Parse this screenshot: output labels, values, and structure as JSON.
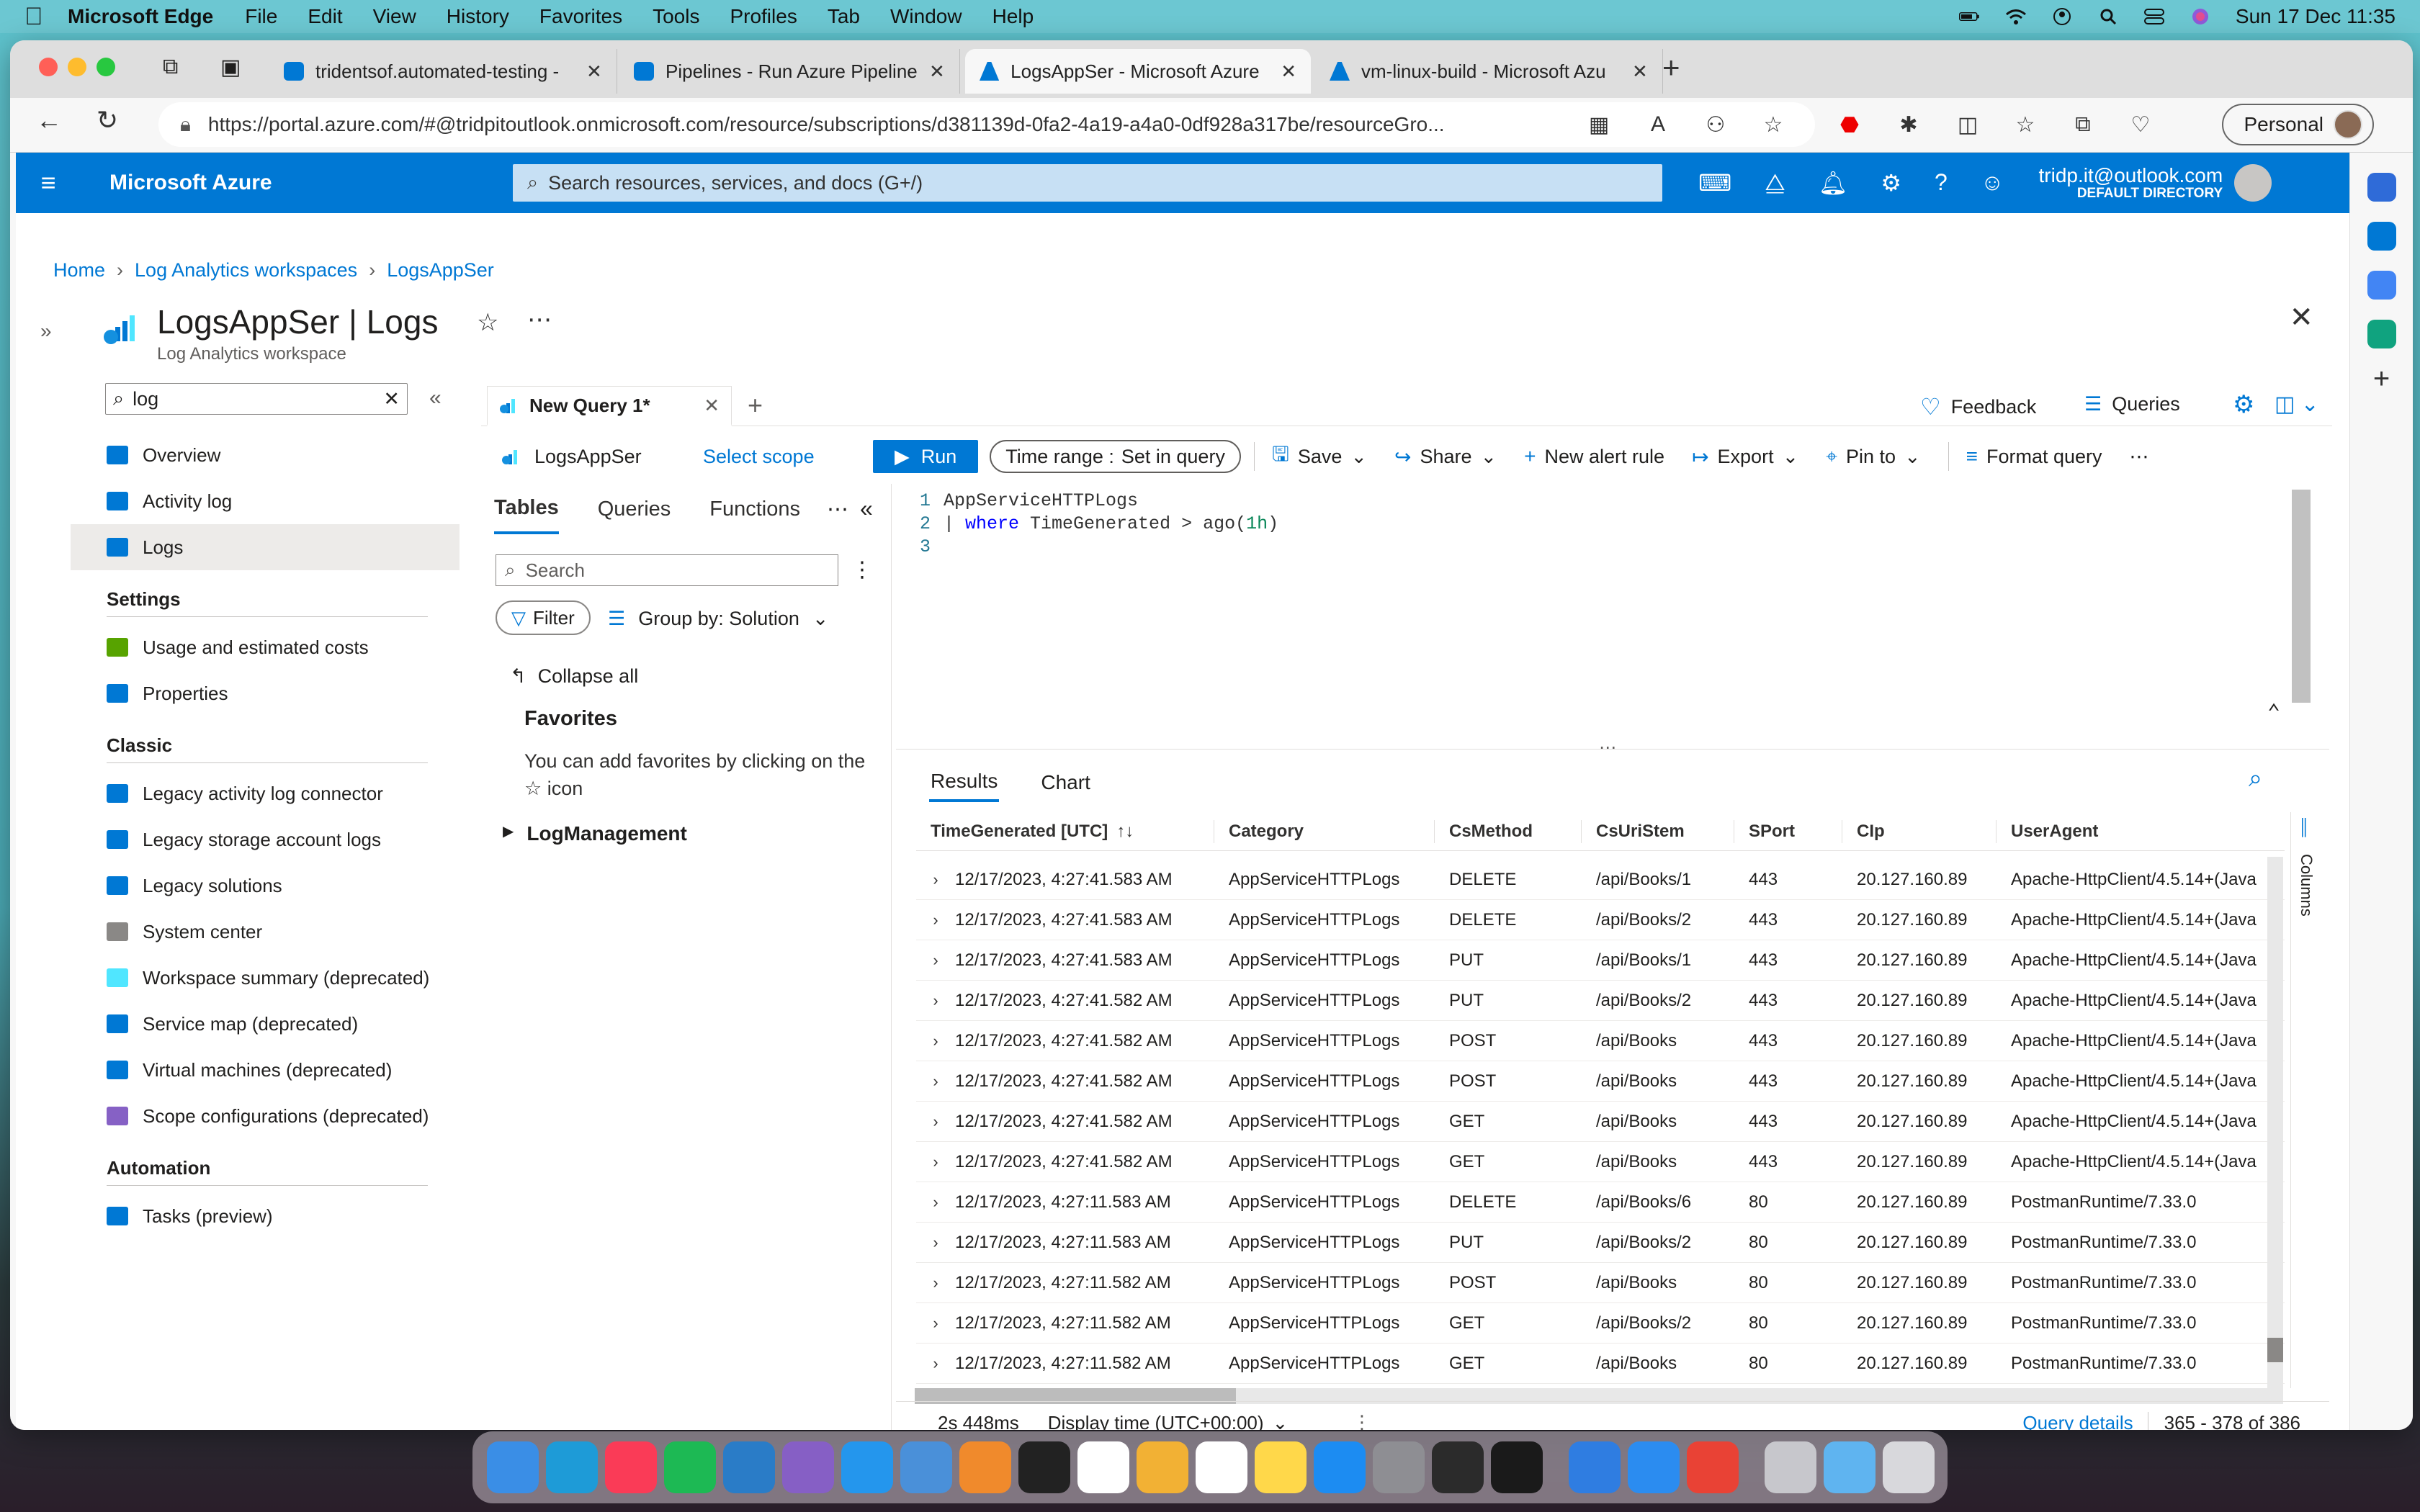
{
  "menubar": {
    "app_name": "Microsoft Edge",
    "menus": [
      "File",
      "Edit",
      "View",
      "History",
      "Favorites",
      "Tools",
      "Profiles",
      "Tab",
      "Window",
      "Help"
    ],
    "clock": "Sun 17 Dec  11:35"
  },
  "browser": {
    "tabs": [
      {
        "label": "tridentsof.automated-testing -",
        "icon": "azure-devops-icon"
      },
      {
        "label": "Pipelines - Run Azure Pipelines",
        "icon": "azure-devops-icon"
      },
      {
        "label": "LogsAppSer - Microsoft Azure",
        "icon": "azure-icon"
      },
      {
        "label": "vm-linux-build - Microsoft Azu",
        "icon": "azure-icon"
      }
    ],
    "url": "https://portal.azure.com/#@tridpitoutlook.onmicrosoft.com/resource/subscriptions/d381139d-0fa2-4a19-a4a0-0df928a317be/resourceGro...",
    "profile_label": "Personal"
  },
  "azure": {
    "brand": "Microsoft Azure",
    "search_placeholder": "Search resources, services, and docs (G+/)",
    "user_email": "tridp.it@outlook.com",
    "user_directory": "DEFAULT DIRECTORY"
  },
  "breadcrumb": [
    "Home",
    "Log Analytics workspaces",
    "LogsAppSer"
  ],
  "blade": {
    "title": "LogsAppSer | Logs",
    "subtitle": "Log Analytics workspace"
  },
  "leftnav": {
    "search_value": "log",
    "items": [
      {
        "label": "Overview",
        "color": "#0078d4",
        "selected": false
      },
      {
        "label": "Activity log",
        "color": "#0078d4",
        "selected": false
      },
      {
        "label": "Logs",
        "color": "#0078d4",
        "selected": true
      }
    ],
    "settings_title": "Settings",
    "settings_items": [
      {
        "label": "Usage and estimated costs",
        "color": "#57a300"
      },
      {
        "label": "Properties",
        "color": "#0078d4"
      }
    ],
    "classic_title": "Classic",
    "classic_items": [
      {
        "label": "Legacy activity log connector",
        "color": "#0078d4"
      },
      {
        "label": "Legacy storage account logs",
        "color": "#0078d4"
      },
      {
        "label": "Legacy solutions",
        "color": "#0078d4"
      },
      {
        "label": "System center",
        "color": "#8a8886"
      },
      {
        "label": "Workspace summary (deprecated)",
        "color": "#50e6ff"
      },
      {
        "label": "Service map (deprecated)",
        "color": "#0078d4"
      },
      {
        "label": "Virtual machines (deprecated)",
        "color": "#0078d4"
      },
      {
        "label": "Scope configurations (deprecated)",
        "color": "#8661c5"
      }
    ],
    "automation_title": "Automation",
    "automation_items": [
      {
        "label": "Tasks (preview)",
        "color": "#0078d4"
      }
    ]
  },
  "query": {
    "tab_label": "New Query 1*",
    "feedback": "Feedback",
    "queries": "Queries",
    "scope_name": "LogsAppSer",
    "select_scope": "Select scope",
    "run": "Run",
    "time_range_label": "Time range :",
    "time_range_value": "Set in query",
    "save": "Save",
    "share": "Share",
    "new_alert": "New alert rule",
    "export": "Export",
    "pin_to": "Pin to",
    "format_query": "Format query"
  },
  "schema": {
    "tabs": [
      "Tables",
      "Queries",
      "Functions"
    ],
    "search_placeholder": "Search",
    "filter": "Filter",
    "group_by": "Group by: Solution",
    "collapse_all": "Collapse all",
    "favorites_title": "Favorites",
    "favorites_text": "You can add favorites by clicking on the ☆ icon",
    "log_management": "LogManagement"
  },
  "editor": {
    "lines": [
      {
        "n": "1",
        "parts": [
          {
            "t": "AppServiceHTTPLogs",
            "c": "plain"
          }
        ]
      },
      {
        "n": "2",
        "parts": [
          {
            "t": "| ",
            "c": "plain"
          },
          {
            "t": "where",
            "c": "kw"
          },
          {
            "t": " TimeGenerated > ago(",
            "c": "plain"
          },
          {
            "t": "1h",
            "c": "num"
          },
          {
            "t": ")",
            "c": "plain"
          }
        ]
      },
      {
        "n": "3",
        "parts": []
      }
    ]
  },
  "results": {
    "tabs": [
      "Results",
      "Chart"
    ],
    "columns": [
      "TimeGenerated [UTC]",
      "Category",
      "CsMethod",
      "CsUriStem",
      "SPort",
      "CIp",
      "UserAgent"
    ],
    "columns_panel": "Columns",
    "rows": [
      [
        "12/17/2023, 4:27:41.583 AM",
        "AppServiceHTTPLogs",
        "DELETE",
        "/api/Books/1",
        "443",
        "20.127.160.89",
        "Apache-HttpClient/4.5.14+(Java"
      ],
      [
        "12/17/2023, 4:27:41.583 AM",
        "AppServiceHTTPLogs",
        "DELETE",
        "/api/Books/2",
        "443",
        "20.127.160.89",
        "Apache-HttpClient/4.5.14+(Java"
      ],
      [
        "12/17/2023, 4:27:41.583 AM",
        "AppServiceHTTPLogs",
        "PUT",
        "/api/Books/1",
        "443",
        "20.127.160.89",
        "Apache-HttpClient/4.5.14+(Java"
      ],
      [
        "12/17/2023, 4:27:41.582 AM",
        "AppServiceHTTPLogs",
        "PUT",
        "/api/Books/2",
        "443",
        "20.127.160.89",
        "Apache-HttpClient/4.5.14+(Java"
      ],
      [
        "12/17/2023, 4:27:41.582 AM",
        "AppServiceHTTPLogs",
        "POST",
        "/api/Books",
        "443",
        "20.127.160.89",
        "Apache-HttpClient/4.5.14+(Java"
      ],
      [
        "12/17/2023, 4:27:41.582 AM",
        "AppServiceHTTPLogs",
        "POST",
        "/api/Books",
        "443",
        "20.127.160.89",
        "Apache-HttpClient/4.5.14+(Java"
      ],
      [
        "12/17/2023, 4:27:41.582 AM",
        "AppServiceHTTPLogs",
        "GET",
        "/api/Books",
        "443",
        "20.127.160.89",
        "Apache-HttpClient/4.5.14+(Java"
      ],
      [
        "12/17/2023, 4:27:41.582 AM",
        "AppServiceHTTPLogs",
        "GET",
        "/api/Books",
        "443",
        "20.127.160.89",
        "Apache-HttpClient/4.5.14+(Java"
      ],
      [
        "12/17/2023, 4:27:11.583 AM",
        "AppServiceHTTPLogs",
        "DELETE",
        "/api/Books/6",
        "80",
        "20.127.160.89",
        "PostmanRuntime/7.33.0"
      ],
      [
        "12/17/2023, 4:27:11.583 AM",
        "AppServiceHTTPLogs",
        "PUT",
        "/api/Books/2",
        "80",
        "20.127.160.89",
        "PostmanRuntime/7.33.0"
      ],
      [
        "12/17/2023, 4:27:11.582 AM",
        "AppServiceHTTPLogs",
        "POST",
        "/api/Books",
        "80",
        "20.127.160.89",
        "PostmanRuntime/7.33.0"
      ],
      [
        "12/17/2023, 4:27:11.582 AM",
        "AppServiceHTTPLogs",
        "GET",
        "/api/Books/2",
        "80",
        "20.127.160.89",
        "PostmanRuntime/7.33.0"
      ],
      [
        "12/17/2023, 4:27:11.582 AM",
        "AppServiceHTTPLogs",
        "GET",
        "/api/Books",
        "80",
        "20.127.160.89",
        "PostmanRuntime/7.33.0"
      ]
    ],
    "exec_time": "2s 448ms",
    "display_time": "Display time (UTC+00:00)",
    "query_details": "Query details",
    "row_range": "365 - 378 of 386"
  },
  "dock": {
    "apps": [
      {
        "name": "finder-icon",
        "color": "#3a8ee6"
      },
      {
        "name": "edge-icon",
        "color": "#1e9bd7"
      },
      {
        "name": "music-icon",
        "color": "#fa3b57"
      },
      {
        "name": "spotify-icon",
        "color": "#1db954"
      },
      {
        "name": "vscode-icon",
        "color": "#2a7cc7"
      },
      {
        "name": "visual-studio-icon",
        "color": "#865fc5"
      },
      {
        "name": "docker-icon",
        "color": "#2496ed"
      },
      {
        "name": "azure-data-studio-icon",
        "color": "#4a90d9"
      },
      {
        "name": "pages-icon",
        "color": "#f08a2c"
      },
      {
        "name": "terminal-icon",
        "color": "#222222"
      },
      {
        "name": "notion-icon",
        "color": "#ffffff"
      },
      {
        "name": "photos-icon",
        "color": "#f2b134"
      },
      {
        "name": "calendar-icon",
        "color": "#ffffff"
      },
      {
        "name": "notes-icon",
        "color": "#ffd84a"
      },
      {
        "name": "app-store-icon",
        "color": "#1c8cf2"
      },
      {
        "name": "system-settings-icon",
        "color": "#8e8e93"
      },
      {
        "name": "console-icon",
        "color": "#2b2b2b"
      },
      {
        "name": "script-editor-icon",
        "color": "#1a1a1a"
      },
      {
        "name": "xcode-icon",
        "color": "#2f7de1"
      },
      {
        "name": "safari-icon",
        "color": "#2b8cf0"
      },
      {
        "name": "chrome-icon",
        "color": "#e94235"
      },
      {
        "name": "help-icon",
        "color": "#c7c7cc"
      },
      {
        "name": "folder-icon",
        "color": "#5fb4f0"
      },
      {
        "name": "trash-icon",
        "color": "#d8d8dc"
      }
    ]
  }
}
